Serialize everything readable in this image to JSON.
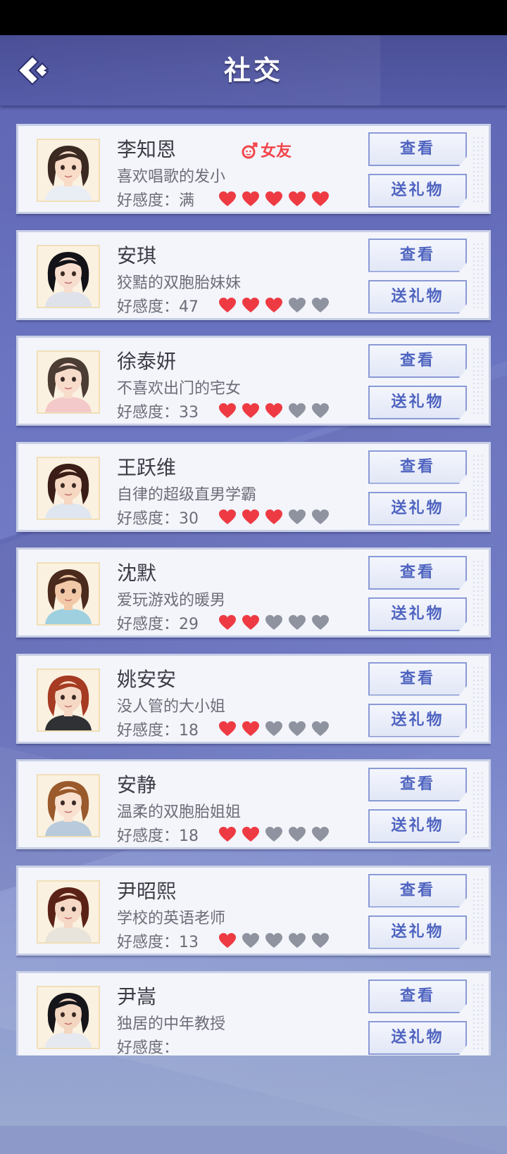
{
  "header": {
    "title": "社交"
  },
  "buttons": {
    "view_label": "查看",
    "gift_label": "送礼物"
  },
  "colors": {
    "heart_full": "#ee3b43",
    "heart_empty": "#8e939f",
    "badge": "#f2464b",
    "accent": "#4f64c0"
  },
  "characters": [
    {
      "name": "李知恩",
      "desc": "喜欢唱歌的发小",
      "affection": "好感度：满",
      "hearts_filled": 5,
      "badge": "女友",
      "hair": "#3b2a22",
      "skin": "#f8dcc8",
      "shirt": "#e9eef5"
    },
    {
      "name": "安琪",
      "desc": "狡黠的双胞胎妹妹",
      "affection": "好感度：47",
      "hearts_filled": 3,
      "hair": "#121218",
      "skin": "#f7ddcd",
      "shirt": "#dfe2ea"
    },
    {
      "name": "徐泰妍",
      "desc": "不喜欢出门的宅女",
      "affection": "好感度：33",
      "hearts_filled": 3,
      "hair": "#4b3c34",
      "skin": "#f8dccb",
      "shirt": "#f3c9c9"
    },
    {
      "name": "王跃维",
      "desc": "自律的超级直男学霸",
      "affection": "好感度：30",
      "hearts_filled": 3,
      "hair": "#3a1d16",
      "skin": "#f6d7c2",
      "shirt": "#dfe6ef"
    },
    {
      "name": "沈默",
      "desc": "爱玩游戏的暖男",
      "affection": "好感度：29",
      "hearts_filled": 2,
      "hair": "#4a2a1c",
      "skin": "#f2c9a8",
      "shirt": "#9fd0e0"
    },
    {
      "name": "姚安安",
      "desc": "没人管的大小姐",
      "affection": "好感度：18",
      "hearts_filled": 2,
      "hair": "#a63a22",
      "skin": "#f6d9c5",
      "shirt": "#2f3134"
    },
    {
      "name": "安静",
      "desc": "温柔的双胞胎姐姐",
      "affection": "好感度：18",
      "hearts_filled": 2,
      "hair": "#9a5a2c",
      "skin": "#f9e0cf",
      "shirt": "#b8cadb"
    },
    {
      "name": "尹昭熙",
      "desc": "学校的英语老师",
      "affection": "好感度：13",
      "hearts_filled": 1,
      "hair": "#5a2216",
      "skin": "#f5d8c5",
      "shirt": "#e8e3db"
    },
    {
      "name": "尹嵩",
      "desc": "独居的中年教授",
      "affection": "好感度：",
      "hearts_filled": 0,
      "hair": "#15151a",
      "skin": "#f3d6c0",
      "shirt": "#e6e9ef"
    }
  ]
}
